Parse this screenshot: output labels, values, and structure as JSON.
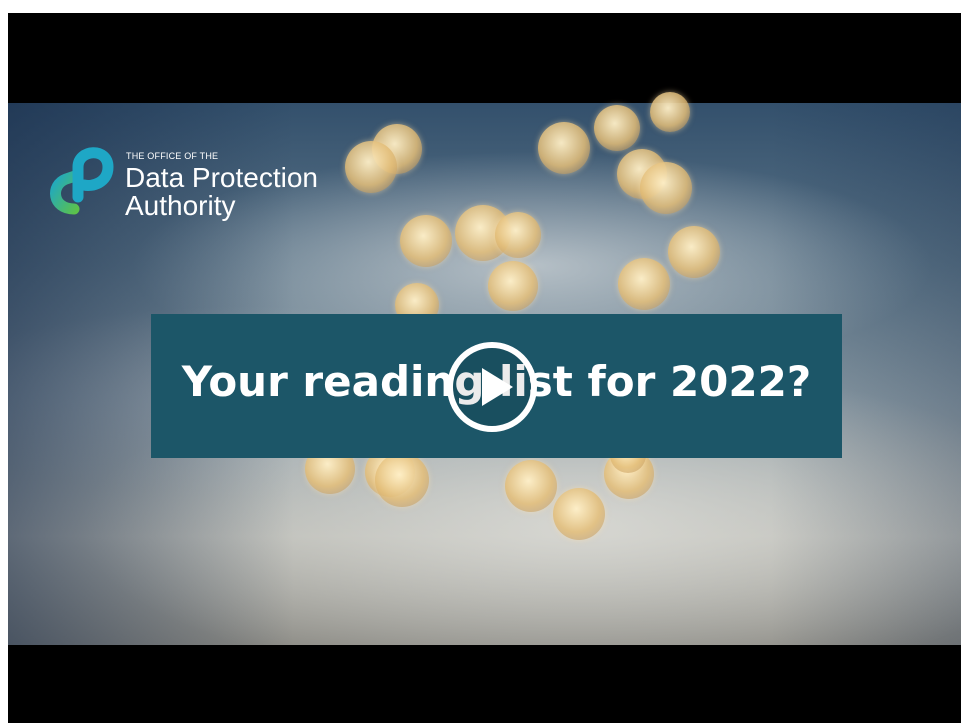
{
  "video": {
    "logo": {
      "small_text": "THE OFFICE OF THE",
      "line1": "Data Protection",
      "line2": "Authority",
      "colors": {
        "teal": "#1ea7c6",
        "green": "#5cc24a"
      }
    },
    "headline": "Your reading list for 2022?",
    "banner_color": "#1c5668",
    "play_icon": "play-icon"
  }
}
